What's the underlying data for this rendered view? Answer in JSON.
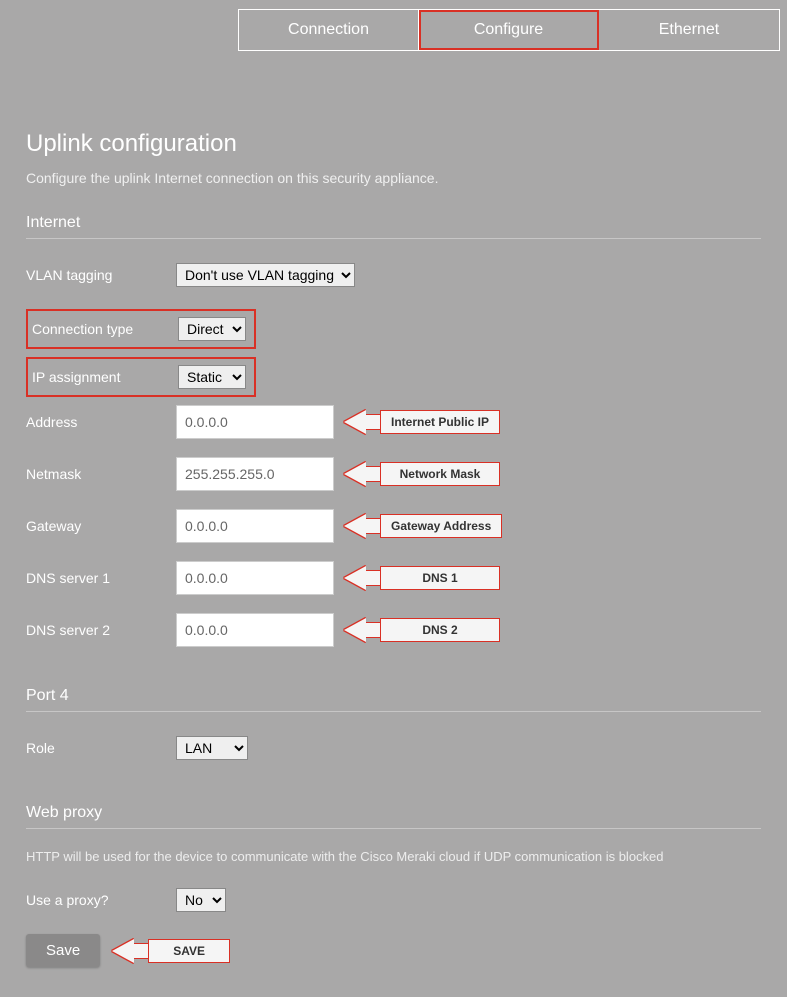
{
  "tabs": {
    "connection": "Connection",
    "configure": "Configure",
    "ethernet": "Ethernet"
  },
  "page": {
    "title": "Uplink configuration",
    "subtitle": "Configure the uplink Internet connection on this security appliance."
  },
  "internet": {
    "heading": "Internet",
    "vlan_label": "VLAN tagging",
    "vlan_value": "Don't use VLAN tagging",
    "conn_type_label": "Connection type",
    "conn_type_value": "Direct",
    "ip_assign_label": "IP assignment",
    "ip_assign_value": "Static",
    "address_label": "Address",
    "address_value": "0.0.0.0",
    "address_callout": "Internet Public IP",
    "netmask_label": "Netmask",
    "netmask_value": "255.255.255.0",
    "netmask_callout": "Network Mask",
    "gateway_label": "Gateway",
    "gateway_value": "0.0.0.0",
    "gateway_callout": "Gateway Address",
    "dns1_label": "DNS server 1",
    "dns1_value": "0.0.0.0",
    "dns1_callout": "DNS 1",
    "dns2_label": "DNS server 2",
    "dns2_value": "0.0.0.0",
    "dns2_callout": "DNS 2"
  },
  "port4": {
    "heading": "Port 4",
    "role_label": "Role",
    "role_value": "LAN"
  },
  "webproxy": {
    "heading": "Web proxy",
    "desc": "HTTP will be used for the device to communicate with the Cisco Meraki cloud if UDP communication is blocked",
    "use_label": "Use a proxy?",
    "use_value": "No"
  },
  "save": {
    "btn": "Save",
    "callout": "SAVE"
  }
}
